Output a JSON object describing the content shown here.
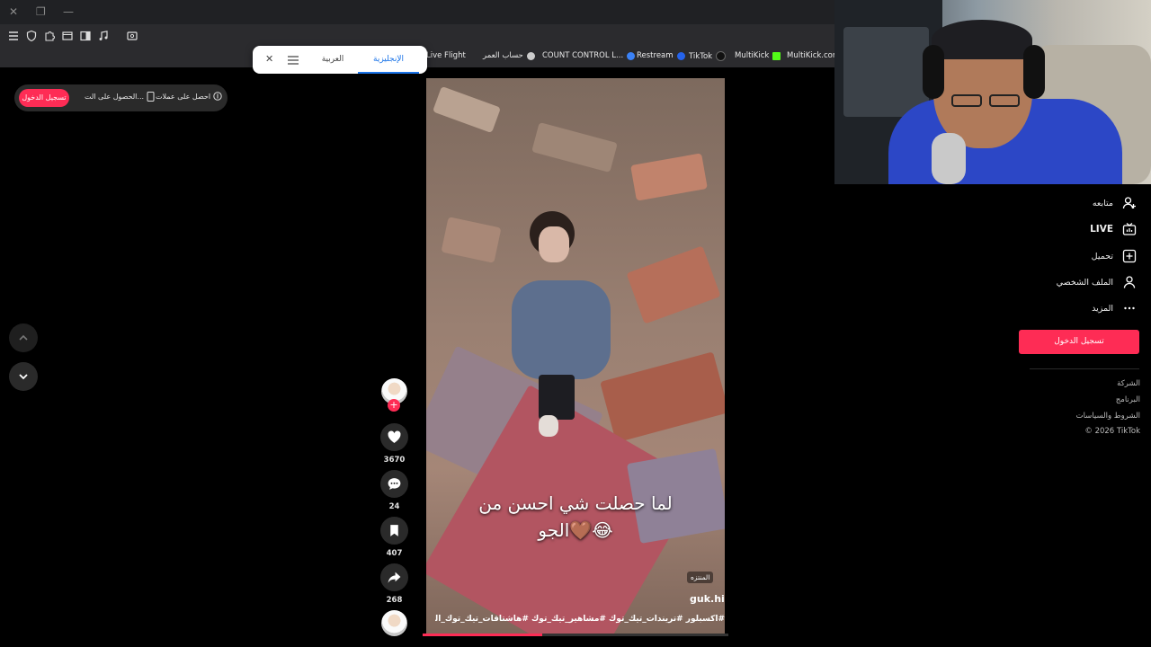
{
  "browser": {
    "bookmarks": [
      {
        "label": "Live Flight",
        "color": "#3b82f6"
      },
      {
        "label": "حساب العمر",
        "color": "#cccccc"
      },
      {
        "label": "COUNT CONTROL L...",
        "color": "#9ca3af"
      },
      {
        "label": "Restream",
        "color": "#2563eb"
      },
      {
        "label": "TikTok",
        "color": "#111111"
      },
      {
        "label": "MultiKick",
        "color": "#53fc18"
      },
      {
        "label": "MultiKick.com",
        "color": "#53fc18"
      }
    ],
    "translate": {
      "lang_en": "الإنجليزية",
      "lang_ar": "العربية"
    }
  },
  "top_pill": {
    "login": "تسجيل الدخول",
    "get_app": "الحصول على الت...",
    "get_coins": "احصل على عملات"
  },
  "video": {
    "caption_line1": "لما حصلت شي احسن من",
    "caption_line2": "الجو🤎😂",
    "promoted": "المنتزه",
    "author": "guk.hik",
    "hashtags": "#اكسبلور #تريندات_تيك_توك #مشاهير_تيك_توك #هاشتاقات_تيك_توك_العرب #طبخ",
    "progress_fraction": 0.39
  },
  "actions": {
    "likes": "3670",
    "comments": "24",
    "saves": "407",
    "shares": "268"
  },
  "right_menu": {
    "following": "متابعه",
    "live": "LIVE",
    "upload": "تحميل",
    "profile": "الملف الشخصي",
    "more": "المزيد",
    "login": "تسجيل الدخول"
  },
  "footer": {
    "company": "الشركة",
    "program": "البرنامج",
    "terms": "الشروط والسياسات",
    "copyright": "© 2026 TikTok"
  },
  "colors": {
    "accent": "#fe2c55",
    "background": "#000000"
  }
}
